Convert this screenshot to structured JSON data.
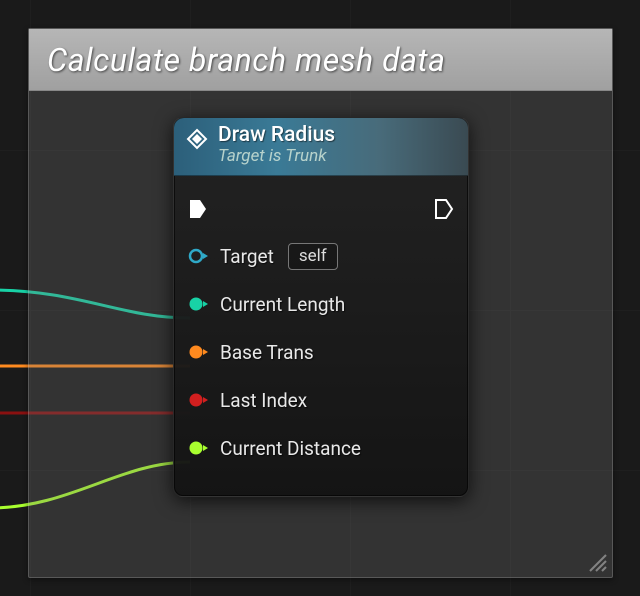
{
  "comment": {
    "title": "Calculate branch mesh data"
  },
  "node": {
    "title": "Draw Radius",
    "subtitle": "Target is Trunk",
    "pins": {
      "target": {
        "label": "Target",
        "default": "self",
        "color": "#2fa9c8"
      },
      "current_length": {
        "label": "Current Length",
        "color": "#18d2a6"
      },
      "base_trans": {
        "label": "Base Trans",
        "color": "#ff8a1f"
      },
      "last_index": {
        "label": "Last Index",
        "color": "#d21f1f"
      },
      "current_distance": {
        "label": "Current Distance",
        "color": "#a9ff2f"
      }
    }
  },
  "wires": [
    {
      "name": "wire-current-length",
      "color": "#18d2a6"
    },
    {
      "name": "wire-base-trans",
      "color": "#ff8a1f"
    },
    {
      "name": "wire-last-index",
      "color": "#d21f1f"
    },
    {
      "name": "wire-current-distance",
      "color": "#a9ff2f"
    }
  ]
}
